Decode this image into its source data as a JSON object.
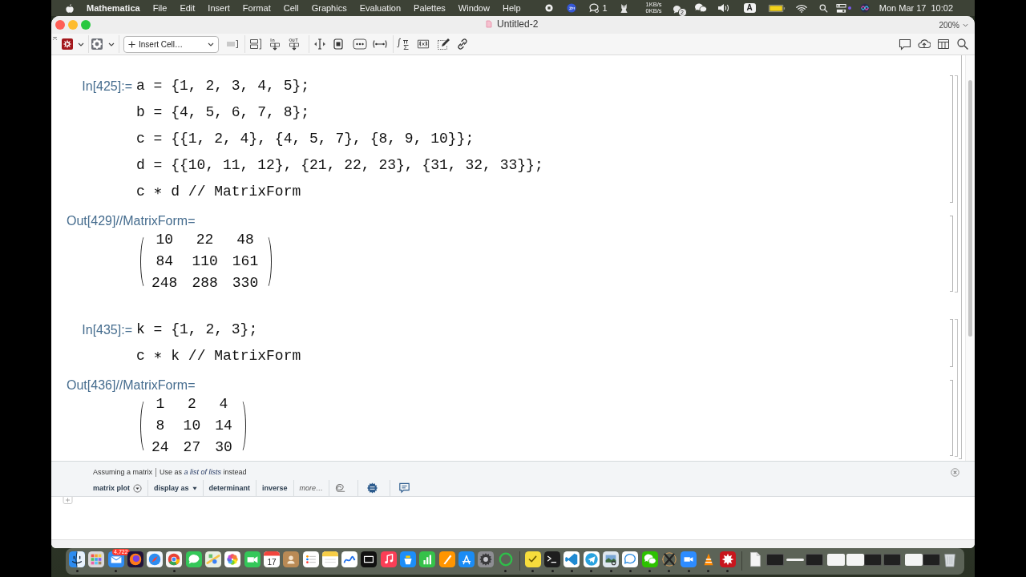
{
  "menu_bar": {
    "app_name": "Mathematica",
    "menus": [
      "File",
      "Edit",
      "Insert",
      "Format",
      "Cell",
      "Graphics",
      "Evaluation",
      "Palettes",
      "Window",
      "Help"
    ],
    "chat_count": "1",
    "upload_rate": "1KB/s",
    "download_rate": "0KB/s",
    "notification_count": "2",
    "input_source": "A",
    "date": "Mon Mar 17",
    "time": "10:02"
  },
  "window": {
    "title": "Untitled-2",
    "zoom": "200%"
  },
  "toolbar": {
    "insert_cell": "Insert Cell…"
  },
  "notebook": {
    "cell_groups": [
      {
        "cells": [
          {
            "kind": "input",
            "label": "In[425]:=",
            "lines": [
              "a = {1, 2, 3, 4, 5};",
              "b = {4, 5, 6, 7, 8};",
              "c = {{1, 2, 4}, {4, 5, 7}, {8, 9, 10}};",
              "d = {{10, 11, 12}, {21, 22, 23}, {31, 32, 33}};",
              "c ∗ d // MatrixForm"
            ]
          },
          {
            "kind": "output",
            "label": "Out[429]//MatrixForm=",
            "matrix": [
              [
                "10",
                "22",
                "48"
              ],
              [
                "84",
                "110",
                "161"
              ],
              [
                "248",
                "288",
                "330"
              ]
            ]
          }
        ]
      },
      {
        "cells": [
          {
            "kind": "input",
            "label": "In[435]:=",
            "lines": [
              "k = {1, 2, 3};",
              "c ∗ k // MatrixForm"
            ]
          },
          {
            "kind": "output",
            "label": "Out[436]//MatrixForm=",
            "matrix": [
              [
                "1",
                "2",
                "4"
              ],
              [
                "8",
                "10",
                "14"
              ],
              [
                "24",
                "27",
                "30"
              ]
            ]
          }
        ]
      }
    ]
  },
  "suggestions_bar": {
    "assumption": "Assuming a matrix",
    "alternative": {
      "before": "Use as",
      "link": "a list of lists",
      "after": "instead"
    },
    "buttons": [
      {
        "label": "matrix plot",
        "kind": "menu"
      },
      {
        "label": "display as",
        "kind": "dropdown"
      },
      {
        "label": "determinant",
        "kind": "plain"
      },
      {
        "label": "inverse",
        "kind": "plain"
      },
      {
        "label": "more…",
        "kind": "more"
      }
    ]
  },
  "dock": {
    "apps": [
      {
        "running": true
      },
      {
        "running": false
      },
      {
        "running": true,
        "badge": "4,722"
      },
      {
        "running": false
      },
      {
        "running": false
      },
      {
        "running": true
      },
      {
        "running": false
      },
      {
        "running": false
      },
      {
        "running": false
      },
      {
        "running": false
      },
      {
        "running": false,
        "day": "17"
      },
      {
        "running": false
      },
      {
        "running": false
      },
      {
        "running": false
      },
      {
        "running": false
      },
      {
        "running": false
      },
      {
        "running": false
      },
      {
        "running": false
      },
      {
        "running": false
      },
      {
        "running": false
      },
      {
        "running": false
      },
      {
        "running": false
      },
      {
        "running": true
      },
      {
        "running": true
      },
      {
        "running": true
      },
      {
        "running": true
      },
      {
        "running": true
      },
      {
        "running": true
      },
      {
        "running": true
      },
      {
        "running": true
      },
      {
        "running": true
      },
      {
        "running": true
      },
      {
        "running": true
      },
      {
        "running": true
      }
    ]
  }
}
